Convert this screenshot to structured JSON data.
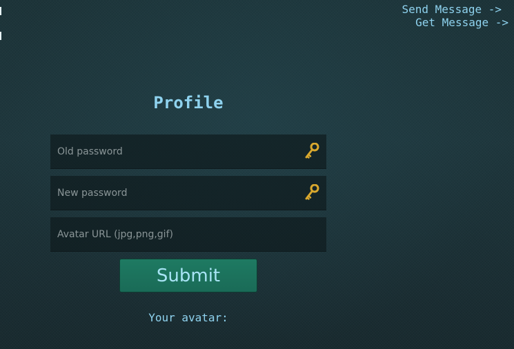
{
  "nav": {
    "send_message": "Send Message ->",
    "get_message": "Get Message ->"
  },
  "profile": {
    "title": "Profile",
    "fields": {
      "old_password": {
        "value": "",
        "placeholder": "Old password",
        "icon": "key-icon"
      },
      "new_password": {
        "value": "",
        "placeholder": "New password",
        "icon": "key-icon"
      },
      "avatar_url": {
        "value": "",
        "placeholder": "Avatar URL (jpg,png,gif)"
      }
    },
    "submit_label": "Submit",
    "avatar_label": "Your avatar:"
  },
  "colors": {
    "accent_text": "#8fd3ef",
    "button_bg": "#1d765f",
    "key_gold": "#d9a82e"
  }
}
